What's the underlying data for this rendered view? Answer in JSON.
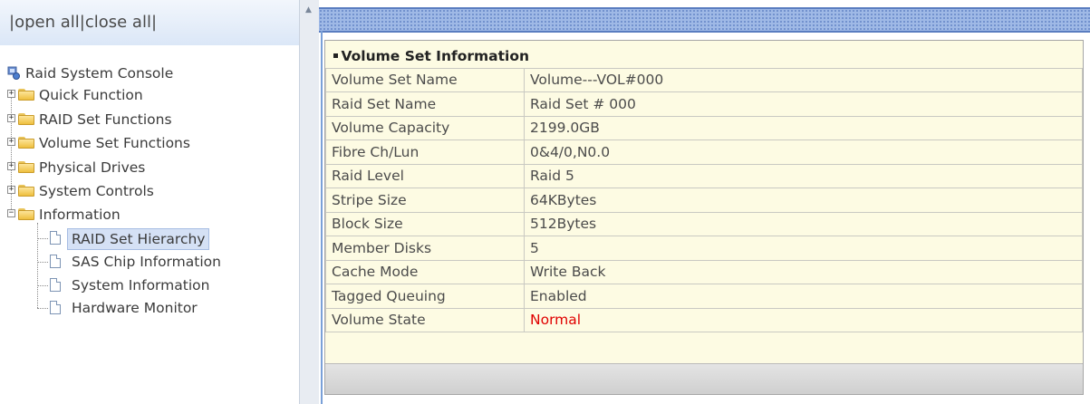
{
  "nav": {
    "links": {
      "prefix": "|",
      "open_all": "open all",
      "sep": "|",
      "close_all": "close all",
      "suffix": "|"
    },
    "root": "Raid System Console",
    "folders": [
      {
        "label": "Quick Function",
        "expander": "+"
      },
      {
        "label": "RAID Set Functions",
        "expander": "+"
      },
      {
        "label": "Volume Set Functions",
        "expander": "+"
      },
      {
        "label": "Physical Drives",
        "expander": "+"
      },
      {
        "label": "System Controls",
        "expander": "+"
      },
      {
        "label": "Information",
        "expander": "−"
      }
    ],
    "info_children": [
      {
        "label": "RAID Set Hierarchy",
        "selected": true
      },
      {
        "label": "SAS Chip Information",
        "selected": false
      },
      {
        "label": "System Information",
        "selected": false
      },
      {
        "label": "Hardware Monitor",
        "selected": false
      }
    ]
  },
  "scrollbar": {
    "arrow": "▲"
  },
  "panel": {
    "title": "Volume Set Information",
    "rows": [
      {
        "key": "Volume Set Name",
        "value": "Volume---VOL#000"
      },
      {
        "key": "Raid Set Name",
        "value": "Raid Set # 000"
      },
      {
        "key": "Volume Capacity",
        "value": "2199.0GB"
      },
      {
        "key": "Fibre Ch/Lun",
        "value": "0&4/0,N0.0"
      },
      {
        "key": "Raid Level",
        "value": "Raid 5"
      },
      {
        "key": "Stripe Size",
        "value": "64KBytes"
      },
      {
        "key": "Block Size",
        "value": "512Bytes"
      },
      {
        "key": "Member Disks",
        "value": "5"
      },
      {
        "key": "Cache Mode",
        "value": "Write Back"
      },
      {
        "key": "Tagged Queuing",
        "value": "Enabled"
      },
      {
        "key": "Volume State",
        "value": "Normal"
      }
    ]
  },
  "colors": {
    "state_normal": "#e00000",
    "panel_bg": "#fdfbe3",
    "topbar": "#9fb9e6"
  }
}
